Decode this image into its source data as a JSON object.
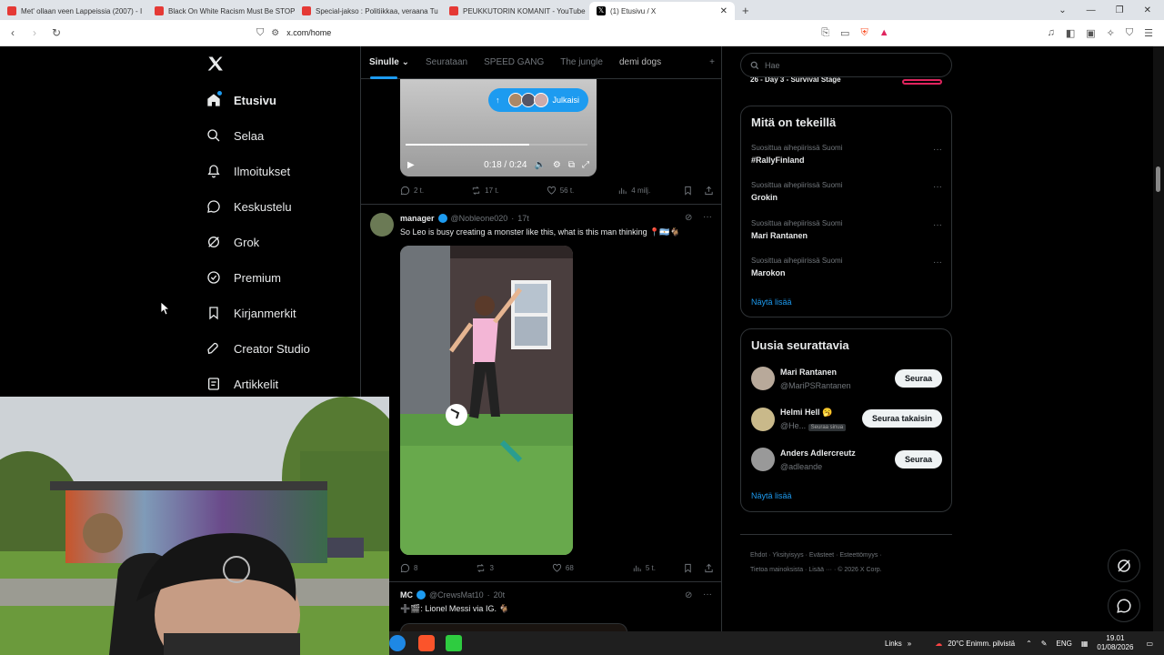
{
  "browser": {
    "tabs": [
      {
        "title": "Met' ollaan veen Lappeissia (2007) - I",
        "favicon_color": "#e53935"
      },
      {
        "title": "Black On White Racism Must Be STOP",
        "favicon_color": "#e53935"
      },
      {
        "title": "Special-jakso : Politiikkaa, veraana Tu",
        "favicon_color": "#e53935"
      },
      {
        "title": "PEUKKUTORIN KOMANIT - YouTube",
        "favicon_color": "#e53935"
      },
      {
        "title": "(1) Etusivu / X",
        "favicon_color": "#000000",
        "active": true
      }
    ],
    "new_tab": "+",
    "url": "x.com/home"
  },
  "sidebar": {
    "items": [
      {
        "label": "Etusivu",
        "icon": "home-icon"
      },
      {
        "label": "Selaa",
        "icon": "search-icon"
      },
      {
        "label": "Ilmoitukset",
        "icon": "bell-icon"
      },
      {
        "label": "Keskustelu",
        "icon": "chat-icon"
      },
      {
        "label": "Grok",
        "icon": "grok-icon"
      },
      {
        "label": "Premium",
        "icon": "premium-icon"
      },
      {
        "label": "Kirjanmerkit",
        "icon": "bookmark-icon"
      },
      {
        "label": "Creator Studio",
        "icon": "rocket-icon"
      },
      {
        "label": "Artikkelit",
        "icon": "article-icon"
      }
    ]
  },
  "feed": {
    "tabs": [
      "Sinulle",
      "Seurataan",
      "SPEED GANG",
      "The jungle",
      "demi dogs"
    ],
    "add_tab": "+",
    "new_posts_label": "Julkaisi",
    "video": {
      "time": "0:18 / 0:24",
      "progress": 0.68
    },
    "post0_actions": {
      "replies": "2 t.",
      "reposts": "17 t.",
      "likes": "56 t.",
      "views": "4 milj."
    },
    "post1": {
      "name": "manager",
      "handle": "@Nobleone020",
      "time": "17t",
      "text": "So Leo is busy creating a monster like this, what is this man thinking 📍🇦🇷🐐",
      "actions": {
        "replies": "8",
        "reposts": "3",
        "likes": "68",
        "views": "5 t."
      }
    },
    "post2": {
      "name": "MC",
      "handle": "@CrewsMat10",
      "time": "20t",
      "text": "➕🎬: Lionel Messi via IG. 🐐"
    }
  },
  "right": {
    "search_placeholder": "Hae",
    "event_partial": "26 - Day 3 - Survival Stage",
    "trending_title": "Mitä on tekeillä",
    "trends": [
      {
        "category": "Suosittua aihepiirissä Suomi",
        "name": "#RallyFinland"
      },
      {
        "category": "Suosittua aihepiirissä Suomi",
        "name": "Grokin"
      },
      {
        "category": "Suosittua aihepiirissä Suomi",
        "name": "Mari Rantanen"
      },
      {
        "category": "Suosittua aihepiirissä Suomi",
        "name": "Marokon"
      }
    ],
    "show_more": "Näytä lisää",
    "who_title": "Uusia seurattavia",
    "who": [
      {
        "name": "Mari Rantanen",
        "handle": "@MariPSRantanen",
        "button": "Seuraa"
      },
      {
        "name": "Helmi Hell 🥱",
        "handle": "@He...",
        "badge": "Seuraa sinua",
        "button": "Seuraa takaisin"
      },
      {
        "name": "Anders Adlercreutz",
        "handle": "@adleande",
        "button": "Seuraa"
      }
    ],
    "who_show_more": "Näytä lisää",
    "footer": [
      "Ehdot",
      "Yksityisyys",
      "Evästeet",
      "Esteettömyys",
      "Tietoa mainoksista",
      "Lisää ···",
      "© 2026 X Corp."
    ]
  },
  "taskbar": {
    "links": "Links",
    "weather": "20°C  Enimm. pilvistä",
    "lang": "ENG",
    "time": "19.01",
    "date": "01/08/2026"
  },
  "colors": {
    "accent": "#1d9bf0",
    "background": "#000000",
    "border": "#2f3336"
  }
}
